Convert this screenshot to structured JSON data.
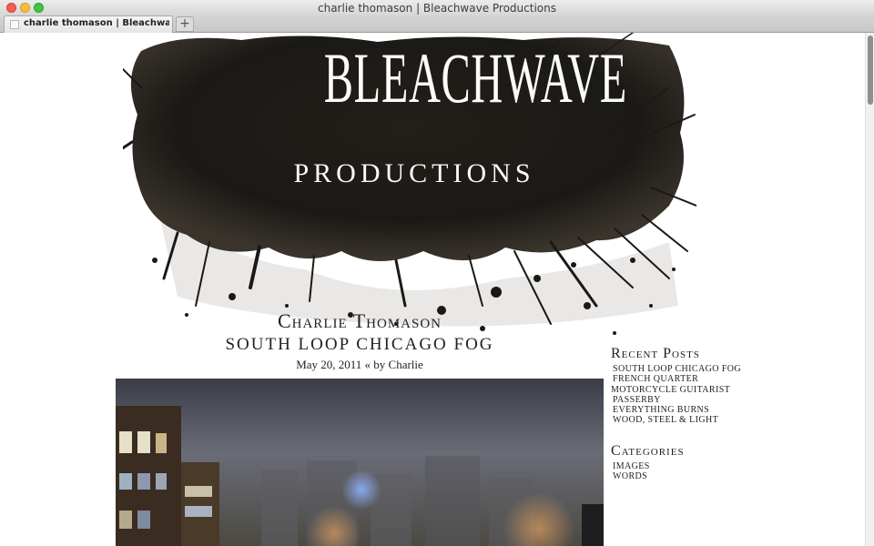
{
  "window": {
    "title": "charlie thomason | Bleachwave Productions",
    "tab_title": "charlie thomason | Bleachwave ...",
    "new_tab_symbol": "+"
  },
  "header": {
    "logo_line1": "BLEACHWAVE",
    "logo_line2": "PRODUCTIONS"
  },
  "site": {
    "title": "Charlie Thomason"
  },
  "post": {
    "title": "SOUTH LOOP CHICAGO FOG",
    "meta": "May 20, 2011 « by Charlie"
  },
  "sidebar": {
    "recent_posts_title": "Recent Posts",
    "recent_posts": [
      "SOUTH LOOP CHICAGO FOG",
      "FRENCH QUARTER",
      "MOTORCYCLE GUITARIST",
      "PASSERBY",
      "EVERYTHING BURNS",
      "WOOD, STEEL & LIGHT"
    ],
    "categories_title": "Categories",
    "categories": [
      "IMAGES",
      "WORDS"
    ]
  },
  "colors": {
    "ink": "#1b1916",
    "text": "#222222",
    "fog_sky": "#55565f"
  }
}
